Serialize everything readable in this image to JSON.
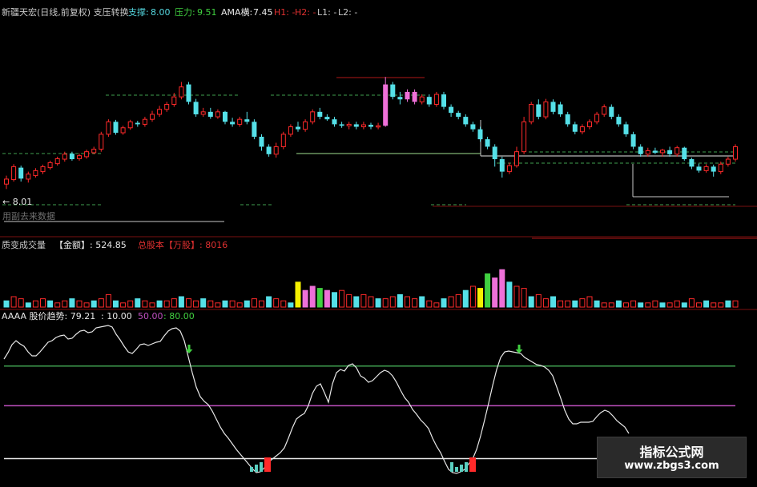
{
  "colors": {
    "up": "#ff2a2a",
    "down": "#55e0e8",
    "pink": "#ee70d8",
    "yellow": "#f5f000",
    "green": "#40d040",
    "white": "#e8e8e8",
    "label": "#c8c8c8",
    "purple": "#c050c0",
    "support_line": "#40a050",
    "red_line": "#b01818"
  },
  "header": {
    "stock": "新疆天宏(日线,前复权) 支压转换",
    "support_label": "支撑:",
    "support_value": "8.00",
    "pressure_label": "压力:",
    "pressure_value": "9.51",
    "ama_label": "AMA横:",
    "ama_value": "7.45",
    "h1": "H1: -",
    "h2": "H2: -",
    "l1": "L1: -",
    "l2": "L2: -"
  },
  "price_pane": {
    "low_marker": "← 8.01",
    "scrub_note": "用副去来数据"
  },
  "volume_pane": {
    "title": "质变成交量",
    "amount_label": "【金额】: 524.85",
    "share_label": "总股本【万股】: 8016"
  },
  "indicator_pane": {
    "title": "AAAA 股价趋势: 79.21",
    "level1": ": 10.00",
    "level2": "50.00",
    "level3": ": 80.00",
    "levels": [
      80,
      50,
      10
    ]
  },
  "watermark": {
    "title": "指标公式网",
    "url": "www.zbgs3.com"
  },
  "chart_data": {
    "type": "candlestick",
    "candles": [
      [
        7.95,
        8.05,
        7.85,
        8.12
      ],
      [
        8.04,
        8.3,
        8.0,
        8.35
      ],
      [
        8.28,
        8.06,
        8.0,
        8.32
      ],
      [
        8.05,
        8.15,
        7.98,
        8.2
      ],
      [
        8.12,
        8.22,
        8.08,
        8.27
      ],
      [
        8.2,
        8.3,
        8.15,
        8.34
      ],
      [
        8.28,
        8.38,
        8.24,
        8.42
      ],
      [
        8.36,
        8.46,
        8.32,
        8.5
      ],
      [
        8.45,
        8.55,
        8.4,
        8.6
      ],
      [
        8.56,
        8.45,
        8.42,
        8.6
      ],
      [
        8.46,
        8.52,
        8.42,
        8.56
      ],
      [
        8.5,
        8.6,
        8.46,
        8.64
      ],
      [
        8.58,
        8.65,
        8.55,
        8.7
      ],
      [
        8.65,
        8.95,
        8.6,
        9.0
      ],
      [
        8.95,
        9.2,
        8.9,
        9.25
      ],
      [
        9.2,
        8.98,
        8.94,
        9.24
      ],
      [
        8.98,
        9.08,
        8.94,
        9.12
      ],
      [
        9.08,
        9.2,
        9.04,
        9.24
      ],
      [
        9.18,
        9.15,
        9.1,
        9.22
      ],
      [
        9.15,
        9.25,
        9.1,
        9.3
      ],
      [
        9.25,
        9.35,
        9.2,
        9.42
      ],
      [
        9.35,
        9.45,
        9.3,
        9.52
      ],
      [
        9.45,
        9.55,
        9.4,
        9.6
      ],
      [
        9.55,
        9.7,
        9.5,
        9.78
      ],
      [
        9.7,
        9.9,
        9.65,
        10.0
      ],
      [
        9.95,
        9.6,
        9.55,
        10.0
      ],
      [
        9.6,
        9.35,
        9.3,
        9.66
      ],
      [
        9.35,
        9.4,
        9.3,
        9.48
      ],
      [
        9.4,
        9.3,
        9.26,
        9.48
      ],
      [
        9.3,
        9.4,
        9.26,
        9.45
      ],
      [
        9.4,
        9.2,
        9.15,
        9.42
      ],
      [
        9.2,
        9.15,
        9.1,
        9.28
      ],
      [
        9.15,
        9.25,
        9.1,
        9.3
      ],
      [
        9.25,
        9.2,
        9.15,
        9.4
      ],
      [
        9.2,
        8.9,
        8.85,
        9.25
      ],
      [
        8.9,
        8.7,
        8.62,
        8.95
      ],
      [
        8.7,
        8.55,
        8.5,
        8.75
      ],
      [
        8.55,
        8.7,
        8.48,
        8.78
      ],
      [
        8.7,
        8.95,
        8.65,
        9.0
      ],
      [
        8.95,
        9.1,
        8.9,
        9.15
      ],
      [
        9.1,
        9.05,
        9.0,
        9.2
      ],
      [
        9.05,
        9.2,
        9.0,
        9.25
      ],
      [
        9.2,
        9.4,
        9.15,
        9.45
      ],
      [
        9.4,
        9.3,
        9.25,
        9.48
      ],
      [
        9.3,
        9.25,
        9.22,
        9.35
      ],
      [
        9.25,
        9.15,
        9.1,
        9.3
      ],
      [
        9.15,
        9.12,
        9.08,
        9.2
      ],
      [
        9.12,
        9.15,
        9.05,
        9.2
      ],
      [
        9.15,
        9.1,
        9.05,
        9.2
      ],
      [
        9.1,
        9.14,
        9.05,
        9.2
      ],
      [
        9.14,
        9.1,
        9.05,
        9.18
      ],
      [
        9.1,
        9.12,
        9.05,
        9.18
      ],
      [
        9.12,
        9.95,
        9.1,
        10.1
      ],
      [
        9.95,
        9.7,
        9.65,
        10.0
      ],
      [
        9.7,
        9.65,
        9.55,
        9.8
      ],
      [
        9.65,
        9.8,
        9.6,
        9.85
      ],
      [
        9.8,
        9.6,
        9.55,
        9.85
      ],
      [
        9.6,
        9.7,
        9.55,
        9.75
      ],
      [
        9.7,
        9.55,
        9.5,
        9.75
      ],
      [
        9.55,
        9.75,
        9.5,
        9.8
      ],
      [
        9.75,
        9.5,
        9.45,
        9.8
      ],
      [
        9.5,
        9.38,
        9.3,
        9.55
      ],
      [
        9.38,
        9.3,
        9.25,
        9.42
      ],
      [
        9.3,
        9.15,
        9.1,
        9.35
      ],
      [
        9.15,
        9.05,
        9.0,
        9.2
      ],
      [
        9.05,
        8.85,
        8.8,
        9.1
      ],
      [
        8.85,
        8.7,
        8.65,
        8.9
      ],
      [
        8.7,
        8.45,
        8.3,
        8.75
      ],
      [
        8.45,
        8.2,
        8.08,
        8.5
      ],
      [
        8.2,
        8.32,
        8.15,
        8.38
      ],
      [
        8.32,
        8.6,
        8.28,
        8.7
      ],
      [
        8.6,
        9.2,
        8.55,
        9.3
      ],
      [
        9.2,
        9.55,
        9.15,
        9.6
      ],
      [
        9.55,
        9.3,
        9.25,
        9.65
      ],
      [
        9.3,
        9.6,
        9.25,
        9.66
      ],
      [
        9.6,
        9.4,
        9.35,
        9.65
      ],
      [
        9.55,
        9.35,
        9.3,
        9.6
      ],
      [
        9.35,
        9.15,
        9.1,
        9.4
      ],
      [
        9.15,
        9.0,
        8.95,
        9.2
      ],
      [
        9.0,
        9.1,
        8.95,
        9.15
      ],
      [
        9.1,
        9.2,
        9.05,
        9.25
      ],
      [
        9.2,
        9.35,
        9.15,
        9.4
      ],
      [
        9.35,
        9.5,
        9.3,
        9.55
      ],
      [
        9.5,
        9.3,
        9.25,
        9.55
      ],
      [
        9.3,
        9.15,
        9.1,
        9.35
      ],
      [
        9.15,
        8.95,
        8.9,
        9.2
      ],
      [
        8.95,
        8.7,
        8.65,
        9.0
      ],
      [
        8.7,
        8.55,
        8.5,
        8.75
      ],
      [
        8.55,
        8.62,
        8.5,
        8.68
      ],
      [
        8.62,
        8.58,
        8.55,
        8.68
      ],
      [
        8.58,
        8.63,
        8.5,
        8.66
      ],
      [
        8.63,
        8.55,
        8.5,
        8.7
      ],
      [
        8.55,
        8.68,
        8.5,
        8.72
      ],
      [
        8.68,
        8.45,
        8.42,
        8.7
      ],
      [
        8.45,
        8.3,
        8.25,
        8.48
      ],
      [
        8.3,
        8.22,
        8.18,
        8.36
      ],
      [
        8.22,
        8.3,
        8.18,
        8.35
      ],
      [
        8.3,
        8.2,
        8.1,
        8.34
      ],
      [
        8.2,
        8.35,
        8.15,
        8.4
      ],
      [
        8.35,
        8.45,
        8.3,
        8.5
      ],
      [
        8.45,
        8.7,
        8.4,
        8.75
      ]
    ],
    "pink_bars": [
      52,
      55,
      56
    ],
    "volumes": [
      3,
      5,
      4,
      2,
      3,
      4,
      3,
      2,
      3,
      4,
      3,
      2,
      3,
      4,
      6,
      3,
      2,
      3,
      4,
      3,
      2,
      3,
      3,
      4,
      5,
      4,
      3,
      4,
      3,
      2,
      3,
      3,
      2,
      3,
      4,
      3,
      5,
      4,
      3,
      2,
      12,
      8,
      10,
      9,
      8,
      7,
      8,
      6,
      5,
      6,
      5,
      4,
      4,
      5,
      6,
      5,
      4,
      5,
      3,
      2,
      4,
      5,
      6,
      8,
      10,
      9,
      16,
      14,
      18,
      12,
      10,
      9,
      5,
      6,
      4,
      5,
      3,
      3,
      3,
      4,
      5,
      3,
      2,
      2,
      3,
      2,
      3,
      2,
      2,
      3,
      2,
      2,
      3,
      2,
      4,
      2,
      3,
      2,
      2,
      3,
      3
    ],
    "vol_yellow": [
      40,
      65
    ],
    "vol_pink": [
      41,
      42,
      44,
      67,
      68
    ],
    "vol_green": [
      43,
      66
    ],
    "trend": [
      [
        0,
        449
      ],
      [
        5,
        441
      ],
      [
        10,
        431
      ],
      [
        15,
        426
      ],
      [
        20,
        430
      ],
      [
        25,
        433
      ],
      [
        30,
        440
      ],
      [
        35,
        445
      ],
      [
        40,
        445
      ],
      [
        45,
        440
      ],
      [
        50,
        434
      ],
      [
        55,
        428
      ],
      [
        60,
        426
      ],
      [
        65,
        422
      ],
      [
        70,
        420
      ],
      [
        75,
        419
      ],
      [
        80,
        424
      ],
      [
        85,
        423
      ],
      [
        90,
        418
      ],
      [
        95,
        414
      ],
      [
        100,
        413
      ],
      [
        105,
        416
      ],
      [
        110,
        415
      ],
      [
        115,
        410
      ],
      [
        120,
        409
      ],
      [
        125,
        408
      ],
      [
        130,
        407
      ],
      [
        135,
        409
      ],
      [
        140,
        418
      ],
      [
        145,
        425
      ],
      [
        150,
        433
      ],
      [
        155,
        440
      ],
      [
        160,
        442
      ],
      [
        165,
        437
      ],
      [
        170,
        431
      ],
      [
        175,
        430
      ],
      [
        180,
        432
      ],
      [
        185,
        430
      ],
      [
        190,
        428
      ],
      [
        195,
        427
      ],
      [
        200,
        420
      ],
      [
        205,
        414
      ],
      [
        210,
        411
      ],
      [
        215,
        410
      ],
      [
        220,
        414
      ],
      [
        225,
        426
      ],
      [
        230,
        446
      ],
      [
        235,
        466
      ],
      [
        240,
        484
      ],
      [
        245,
        496
      ],
      [
        250,
        502
      ],
      [
        255,
        506
      ],
      [
        260,
        514
      ],
      [
        265,
        524
      ],
      [
        270,
        534
      ],
      [
        275,
        542
      ],
      [
        280,
        548
      ],
      [
        285,
        555
      ],
      [
        290,
        562
      ],
      [
        295,
        568
      ],
      [
        300,
        574
      ],
      [
        305,
        580
      ],
      [
        310,
        586
      ],
      [
        315,
        591
      ],
      [
        320,
        590
      ],
      [
        325,
        585
      ],
      [
        330,
        578
      ],
      [
        335,
        574
      ],
      [
        340,
        570
      ],
      [
        345,
        566
      ],
      [
        350,
        560
      ],
      [
        355,
        548
      ],
      [
        360,
        535
      ],
      [
        365,
        524
      ],
      [
        370,
        520
      ],
      [
        375,
        517
      ],
      [
        380,
        507
      ],
      [
        385,
        492
      ],
      [
        390,
        483
      ],
      [
        395,
        480
      ],
      [
        400,
        491
      ],
      [
        405,
        503
      ],
      [
        410,
        480
      ],
      [
        415,
        466
      ],
      [
        420,
        462
      ],
      [
        425,
        464
      ],
      [
        430,
        457
      ],
      [
        435,
        455
      ],
      [
        440,
        460
      ],
      [
        445,
        470
      ],
      [
        450,
        473
      ],
      [
        455,
        478
      ],
      [
        460,
        476
      ],
      [
        465,
        471
      ],
      [
        470,
        466
      ],
      [
        475,
        463
      ],
      [
        480,
        465
      ],
      [
        485,
        470
      ],
      [
        490,
        478
      ],
      [
        495,
        488
      ],
      [
        500,
        497
      ],
      [
        505,
        503
      ],
      [
        510,
        512
      ],
      [
        515,
        518
      ],
      [
        520,
        525
      ],
      [
        525,
        530
      ],
      [
        530,
        536
      ],
      [
        535,
        548
      ],
      [
        540,
        558
      ],
      [
        545,
        566
      ],
      [
        550,
        577
      ],
      [
        555,
        587
      ],
      [
        560,
        591
      ],
      [
        565,
        592
      ],
      [
        570,
        590
      ],
      [
        575,
        587
      ],
      [
        580,
        580
      ],
      [
        585,
        574
      ],
      [
        590,
        562
      ],
      [
        595,
        545
      ],
      [
        600,
        525
      ],
      [
        605,
        504
      ],
      [
        610,
        482
      ],
      [
        615,
        462
      ],
      [
        620,
        447
      ],
      [
        625,
        440
      ],
      [
        630,
        439
      ],
      [
        635,
        440
      ],
      [
        640,
        441
      ],
      [
        645,
        442
      ],
      [
        650,
        447
      ],
      [
        655,
        450
      ],
      [
        660,
        453
      ],
      [
        665,
        456
      ],
      [
        670,
        457
      ],
      [
        675,
        459
      ],
      [
        680,
        463
      ],
      [
        685,
        470
      ],
      [
        690,
        484
      ],
      [
        695,
        498
      ],
      [
        700,
        513
      ],
      [
        705,
        524
      ],
      [
        710,
        530
      ],
      [
        715,
        530
      ],
      [
        720,
        528
      ],
      [
        725,
        528
      ],
      [
        730,
        528
      ],
      [
        735,
        527
      ],
      [
        740,
        521
      ],
      [
        745,
        516
      ],
      [
        750,
        513
      ],
      [
        755,
        515
      ],
      [
        760,
        520
      ],
      [
        765,
        526
      ],
      [
        770,
        530
      ],
      [
        775,
        534
      ],
      [
        780,
        542
      ]
    ]
  }
}
